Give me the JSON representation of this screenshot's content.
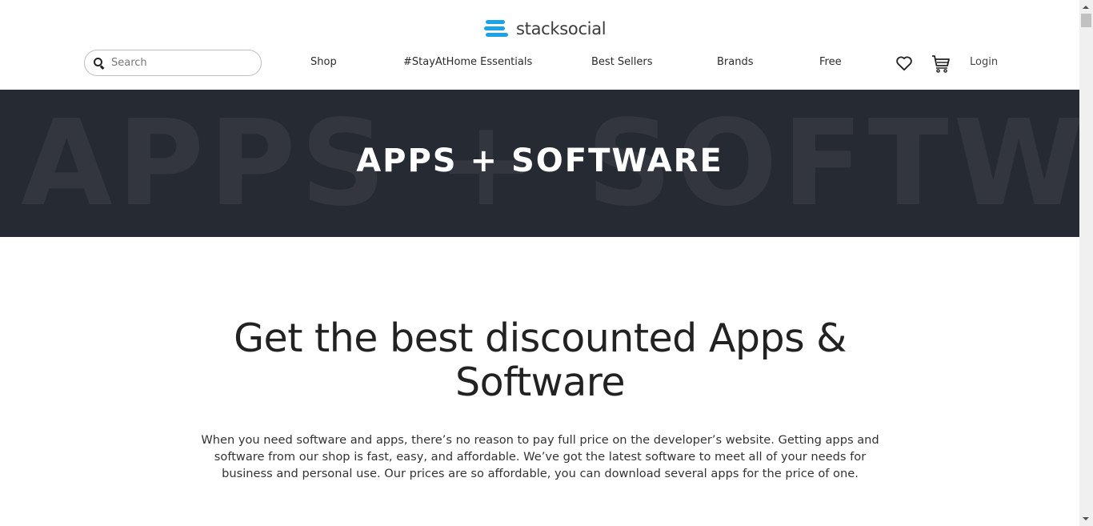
{
  "brand": {
    "name": "stacksocial",
    "logo_icon": "stacked-bars-logo-icon",
    "accent_color": "#1aa3e8"
  },
  "header": {
    "search": {
      "placeholder": "Search",
      "value": "",
      "icon": "search-icon"
    },
    "nav": [
      {
        "label": "Shop"
      },
      {
        "label": "#StayAtHome Essentials"
      },
      {
        "label": "Best Sellers"
      },
      {
        "label": "Brands"
      },
      {
        "label": "Free"
      }
    ],
    "wishlist_icon": "heart-icon",
    "cart_icon": "cart-icon",
    "login_label": "Login"
  },
  "hero": {
    "background_text": "APPS + SOFTWARE",
    "title": "APPS + SOFTWARE",
    "background_color": "#262a33"
  },
  "content": {
    "headline": "Get the best discounted Apps & Software",
    "intro": "When you need software and apps, there’s no reason to pay full price on the developer’s website. Getting apps and software from our shop is fast, easy, and affordable. We’ve got the latest software to meet all of your needs for business and personal use. Our prices are so affordable, you can download several apps for the price of one."
  }
}
